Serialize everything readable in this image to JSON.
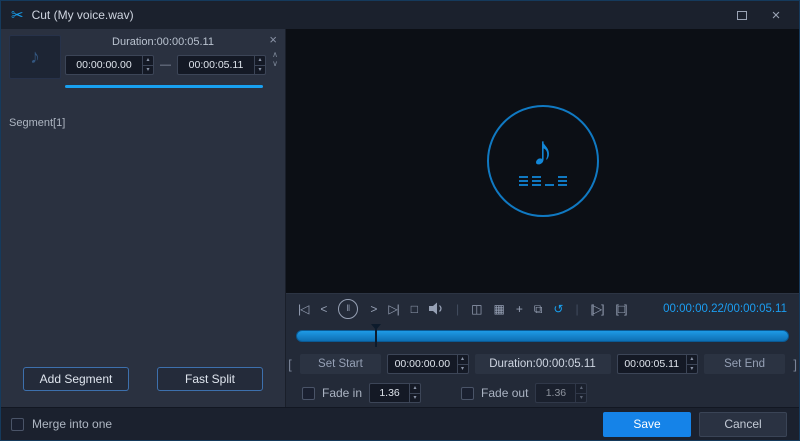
{
  "window": {
    "title": "Cut (My voice.wav)"
  },
  "icons": {
    "scissors": "✂",
    "close": "×",
    "note": "♪",
    "segment_close": "×",
    "chevron_up": "∧",
    "chevron_down": "∨",
    "spin_up": "▴",
    "spin_down": "▾",
    "dash": "—",
    "go_start": "|◁",
    "step_back": "<",
    "pause": "‖",
    "step_forward": ">",
    "go_end": "▷|",
    "stop": "□",
    "divider": "|",
    "split": "◫",
    "tiles": "▦",
    "plus": "+",
    "copy": "⧉",
    "reset": "↺",
    "play_bracket": "[▷]",
    "stop_bracket": "[□]",
    "bracket_left": "[",
    "bracket_right": "]"
  },
  "segment_panel": {
    "duration_label": "Duration:00:00:05.11",
    "start_value": "00:00:00.00",
    "end_value": "00:00:05.11",
    "segment_label": "Segment[1]",
    "add_segment": "Add Segment",
    "fast_split": "Fast Split"
  },
  "transport": {
    "current_time": "00:00:00.22",
    "separator": "/",
    "total_time": "00:00:05.11"
  },
  "trim": {
    "set_start": "Set Start",
    "start_value": "00:00:00.00",
    "duration_label": "Duration:00:00:05.11",
    "end_value": "00:00:05.11",
    "set_end": "Set End"
  },
  "fade": {
    "fade_in_label": "Fade in",
    "fade_in_value": "1.36",
    "fade_out_label": "Fade out",
    "fade_out_value": "1.36"
  },
  "footer": {
    "merge_label": "Merge into one",
    "save": "Save",
    "cancel": "Cancel"
  },
  "colors": {
    "accent": "#18a0f0",
    "timeline": "#1287d8",
    "save_button": "#1583e8",
    "preview_bg": "#0c0f15"
  }
}
